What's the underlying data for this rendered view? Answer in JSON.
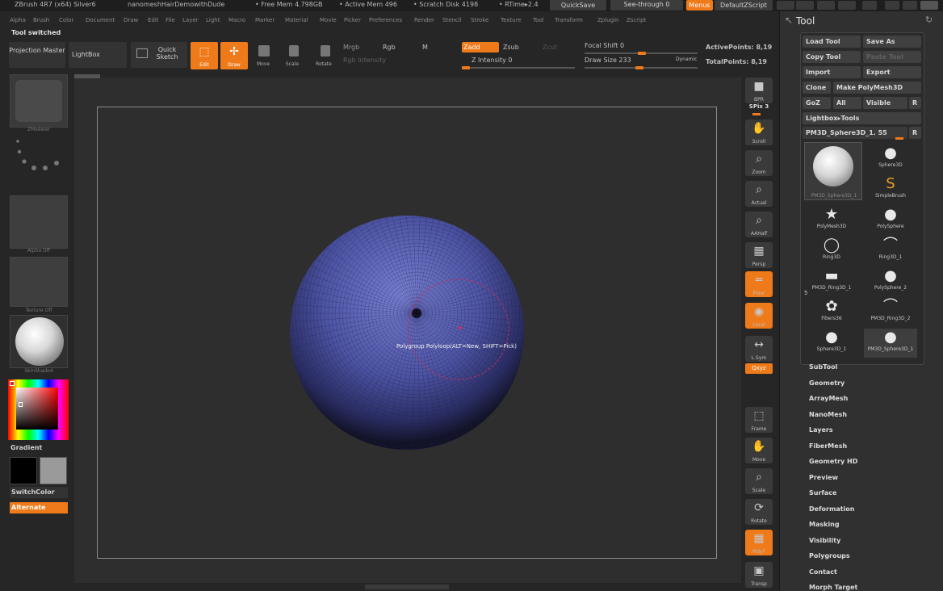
{
  "titlebar": {
    "app": "ZBrush 4R7 (x64) Silver6",
    "document": "nanomeshHairDemowithDude",
    "free_mem": "• Free Mem 4.798GB",
    "active_mem": "• Active Mem 496",
    "scratch": "• Scratch Disk 4198",
    "rtime": "• RTime▸2.4",
    "quicksave": "QuickSave",
    "see_through": "See-through   0",
    "menus": "Menus",
    "default_zscript": "DefaultZScript"
  },
  "menu": [
    "Alpha",
    "Brush",
    "Color",
    "Document",
    "Draw",
    "Edit",
    "File",
    "Layer",
    "Light",
    "Macro",
    "Marker",
    "Material",
    "Movie",
    "Picker",
    "Preferences",
    "Render",
    "Stencil",
    "Stroke",
    "Texture",
    "Tool",
    "Transform",
    "Zplugin",
    "Zscript"
  ],
  "status": "Tool switched",
  "topbar": {
    "projection_master": "Projection Master",
    "lightbox": "LightBox",
    "quick_sketch": "Quick Sketch",
    "edit": "Edit",
    "draw": "Draw",
    "move": "Move",
    "scale": "Scale",
    "rotate": "Rotate",
    "mrgb": "Mrgb",
    "rgb": "Rgb",
    "m": "M",
    "rgb_intensity": "Rgb Intensity",
    "zadd": "Zadd",
    "zsub": "Zsub",
    "zcut": "Zcut",
    "z_intensity": "Z Intensity 0",
    "focal_shift": "Focal Shift 0",
    "draw_size": "Draw Size 233",
    "dynamic": "Dynamic",
    "active_points": "ActivePoints: 8,19",
    "total_points": "TotalPoints: 8,19"
  },
  "left": {
    "brush_label": "ZModeler",
    "alpha_label": "Alpha Off",
    "texture_label": "Texture Off",
    "material_label": "SkinShade4",
    "gradient": "Gradient",
    "switch_color": "SwitchColor",
    "alternate": "Alternate"
  },
  "viewport": {
    "tooltip": "Polygroup Polyloop(ALT=New, SHIFT=Pick)"
  },
  "shelf": [
    {
      "label": "BPR",
      "glyph": "■"
    },
    {
      "label": "SPix 3",
      "glyph": ""
    },
    {
      "label": "Scroll",
      "glyph": "✋"
    },
    {
      "label": "Zoom",
      "glyph": "⌕"
    },
    {
      "label": "Actual",
      "glyph": "⌕"
    },
    {
      "label": "AAHalf",
      "glyph": "⌕"
    },
    {
      "label": "Persp",
      "glyph": "▦"
    },
    {
      "label": "Floor",
      "glyph": "═"
    },
    {
      "label": "Local",
      "glyph": "◉"
    },
    {
      "label": "L.Sym",
      "glyph": "↔"
    },
    {
      "label": "Qxyz",
      "glyph": ""
    },
    {
      "label": "Frame",
      "glyph": "⬚"
    },
    {
      "label": "Move",
      "glyph": "✋"
    },
    {
      "label": "Scale",
      "glyph": "⌕"
    },
    {
      "label": "Rotate",
      "glyph": "⟳"
    },
    {
      "label": "PolyF",
      "glyph": "▦"
    },
    {
      "label": "Transp",
      "glyph": "▣"
    }
  ],
  "tool": {
    "title": "Tool",
    "load_tool": "Load Tool",
    "save_as": "Save As",
    "copy_tool": "Copy Tool",
    "paste_tool": "Paste Tool",
    "import": "Import",
    "export": "Export",
    "clone": "Clone",
    "make_polymesh": "Make PolyMesh3D",
    "goz": "GoZ",
    "all": "All",
    "visible": "Visible",
    "r": "R",
    "lightbox_tools": "Lightbox▸Tools",
    "current_tool": "PM3D_Sphere3D_1. 55",
    "current_tool_thumb_label": "PM3D_Sphere3D_1",
    "items": [
      {
        "label": "Sphere3D",
        "glyph": "●"
      },
      {
        "label": "SimpleBrush",
        "glyph": "S"
      },
      {
        "label": "PolyMesh3D",
        "glyph": "★"
      },
      {
        "label": "PolySphere",
        "glyph": "●"
      },
      {
        "label": "Ring3D",
        "glyph": "◯"
      },
      {
        "label": "Ring3D_1",
        "glyph": "⌒"
      },
      {
        "label": "PM3D_Ring3D_1",
        "glyph": "▬"
      },
      {
        "label": "PolySphere_2",
        "glyph": "●"
      },
      {
        "label": "Fibers36",
        "glyph": "✿"
      },
      {
        "label": "PM3D_Ring3D_2",
        "glyph": "⌒"
      },
      {
        "label": "Sphere3D_1",
        "glyph": "●"
      },
      {
        "label": "PM3D_Sphere3D_1",
        "glyph": "●"
      }
    ],
    "count_badge": "5",
    "sections": [
      "SubTool",
      "Geometry",
      "ArrayMesh",
      "NanoMesh",
      "Layers",
      "FiberMesh",
      "Geometry HD",
      "Preview",
      "Surface",
      "Deformation",
      "Masking",
      "Visibility",
      "Polygroups",
      "Contact",
      "Morph Target"
    ]
  }
}
